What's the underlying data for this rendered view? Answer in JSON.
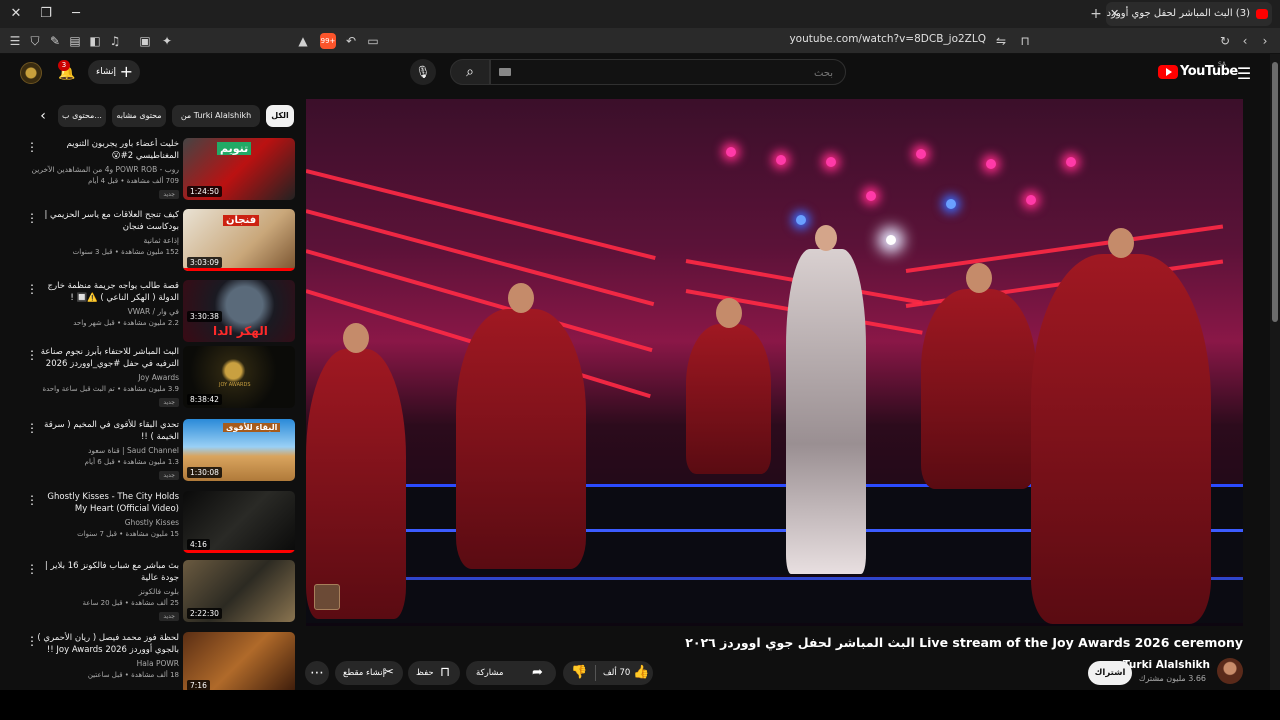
{
  "browser": {
    "tab_title": "(3) البث المباشر لحفل جوي أوورد",
    "url": "youtube.com/watch?v=8DCB_jo2ZLQ",
    "shield_count": "99+"
  },
  "masthead": {
    "logo_text": "YouTube",
    "logo_region": "SA",
    "search_placeholder": "بحث",
    "create_label": "إنشاء",
    "notification_count": "3"
  },
  "video": {
    "title": "البث المباشر لحفل جوي اووردز ٢٠٢٦ Live stream of the Joy Awards 2026 ceremony",
    "channel": "Turki Alalshikh",
    "subscribers": "3.66 مليون مشترك",
    "subscribe_label": "اشتراك",
    "likes": "70 ألف",
    "share_label": "مشاركة",
    "save_label": "حفظ",
    "clip_label": "إنشاء مقطع"
  },
  "chips": [
    "الكل",
    "من Turki Alalshikh",
    "محتوى مشابه",
    "محتوى ب..."
  ],
  "recommendations": [
    {
      "title": "خليت أعضاء باور يجربون الثنويم المغناطيسي 2#😮",
      "channel": "روب - POWR ROB و4 من المشاهدين الآخرين",
      "meta": "709 ألف مشاهدة • قبل 4 أيام",
      "badge": "جديد",
      "duration": "1:24:50",
      "thumb_text": "تنويم"
    },
    {
      "title": "كيف تنجح العلاقات مع ياسر الحزيمي | بودكاست فنجان",
      "channel": "إذاعة ثمانية",
      "meta": "152 مليون مشاهدة • قبل 3 سنوات",
      "badge": "",
      "duration": "3:03:09",
      "thumb_text": "فنجان"
    },
    {
      "title": "قصة طالب يواجه جريمة منظمة خارج الدولة ( الهكر الناعي ) ⚠️🔲 !",
      "channel": "في وار / VWAR",
      "meta": "2.2 مليون مشاهدة • قبل شهر واحد",
      "badge": "",
      "duration": "3:30:38",
      "thumb_text": "الهكر الدا"
    },
    {
      "title": "البث المباشر للاحتفاء بأبرز نجوم صناعة الترفيه في حفل #جوي_اووردز 2026",
      "channel": "Joy Awards",
      "meta": "3.9 مليون مشاهدة • تم البث قبل ساعة واحدة",
      "badge": "جديد",
      "duration": "8:38:42",
      "thumb_text": "JOY AWARDS"
    },
    {
      "title": "تحدي البقاء للأقوى في المخيم ( سرقة الخيمة ) !!",
      "channel": "Saud Channel | قناة سعود",
      "meta": "1.3 مليون مشاهدة • قبل 6 أيام",
      "badge": "جديد",
      "duration": "1:30:08",
      "thumb_text": "البقاء للأقوى"
    },
    {
      "title": "Ghostly Kisses - The City Holds My Heart (Official Video)",
      "channel": "Ghostly Kisses",
      "meta": "15 مليون مشاهدة • قبل 7 سنوات",
      "badge": "",
      "duration": "4:16",
      "thumb_text": ""
    },
    {
      "title": "بث مباشر مع شباب فالكونز 16 بلاير | جودة عالية",
      "channel": "بلوت فالكونز",
      "meta": "25 ألف مشاهدة • قبل 20 ساعة",
      "badge": "جديد",
      "duration": "2:22:30",
      "thumb_text": ""
    },
    {
      "title": "لحظة فوز محمد فيصل ( ريان الأحمري ) بالجوي أووردز Joy Awards 2026 !!",
      "channel": "Hala POWR",
      "meta": "18 ألف مشاهدة • قبل ساعتين",
      "badge": "",
      "duration": "7:16",
      "thumb_text": ""
    }
  ],
  "colors": {
    "accent": "#ff0000",
    "background": "#0f0f0f",
    "chip_bg": "#272727"
  }
}
